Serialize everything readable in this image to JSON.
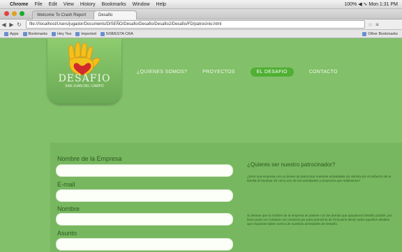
{
  "menubar": {
    "apple": "",
    "items": [
      "Chrome",
      "File",
      "Edit",
      "View",
      "History",
      "Bookmarks",
      "Window",
      "Help"
    ],
    "status": "100% ◀ ∿ Mon 1:31 PM"
  },
  "browser": {
    "tab1": "Welcome To Crash Report",
    "tab2": "Desafio",
    "url": "file:///localhost/Users/jugador/Documents/DISEÑO/Desafio/Desafio/Desafio2/Desafio/FD/patrocinio.html",
    "bookmarks": [
      "Apps",
      "Bookmarks",
      "Hey Tea",
      "Imported",
      "5/08/ESTA CRA"
    ],
    "bookmarks_right": "Other Bookmarks"
  },
  "site": {
    "logo_text": "DESAFIO",
    "logo_sub": "SAN JUAN DEL CAMPO",
    "nav": [
      "¿QUIENES SOMOS?",
      "PROYECTOS",
      "EL DESAFIO",
      "CONTACTO"
    ],
    "active_nav": "EL DESAFIO"
  },
  "form": {
    "fields": [
      {
        "label": "Nombre de la Empresa",
        "value": ""
      },
      {
        "label": "E-mail",
        "value": ""
      },
      {
        "label": "Nombre",
        "value": ""
      },
      {
        "label": "Asunto",
        "value": ""
      }
    ]
  },
  "sidebar": {
    "title": "¿Quieres ser nuestro patrocinador?",
    "para1": "¿Eres una empresa con un deseo de patrocinar nuestras actividades y/o admira por el esfuerzo de la familia al impulsar de cerca uno de las actividades y proyectos que realizamos?",
    "para2": "Si deseas que tu nombre de la empresa se plasme con los demás que apoyamos Desafío podrás, por favor poner en contacto con nosotros por para patrocinio de formulario llenar todos aquellos detalles que requieras saber acerca de nuestras actividades de Desafío."
  },
  "colors": {
    "page_bg": "#82c06a",
    "nav_active": "#4fb032",
    "logo_hand_yellow": "#f2c21a",
    "logo_heart": "#d12b2b"
  }
}
